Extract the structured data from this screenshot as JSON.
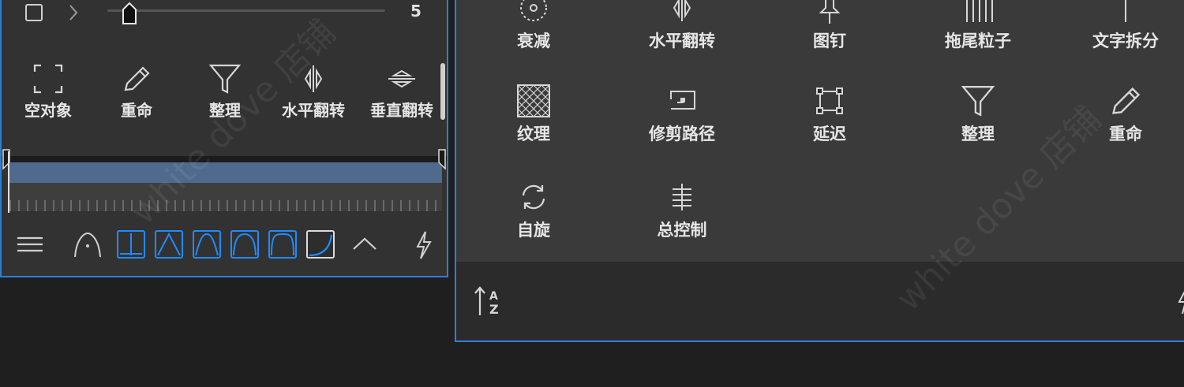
{
  "left_panel": {
    "slider_value": "5",
    "tools": [
      {
        "label": "空对象",
        "icon": "null-object-icon"
      },
      {
        "label": "重命",
        "icon": "pencil-icon"
      },
      {
        "label": "整理",
        "icon": "funnel-icon"
      },
      {
        "label": "水平翻转",
        "icon": "flip-horizontal-icon"
      },
      {
        "label": "垂直翻转",
        "icon": "flip-vertical-icon"
      }
    ]
  },
  "right_panel": {
    "items": [
      {
        "label": "衰减",
        "icon": "falloff-icon"
      },
      {
        "label": "水平翻转",
        "icon": "flip-horizontal-icon"
      },
      {
        "label": "图钉",
        "icon": "pin-icon"
      },
      {
        "label": "拖尾粒子",
        "icon": "trail-particles-icon"
      },
      {
        "label": "文字拆分",
        "icon": "text-split-icon"
      },
      {
        "label": "纹理",
        "icon": "texture-icon"
      },
      {
        "label": "修剪路径",
        "icon": "trim-path-icon"
      },
      {
        "label": "延迟",
        "icon": "delay-icon"
      },
      {
        "label": "整理",
        "icon": "funnel-icon"
      },
      {
        "label": "重命",
        "icon": "pencil-icon"
      },
      {
        "label": "自旋",
        "icon": "spin-icon"
      },
      {
        "label": "总控制",
        "icon": "master-control-icon"
      }
    ]
  },
  "watermark": "white dove 店铺",
  "colors": {
    "accent": "#1f8cff",
    "panel_border": "#2f7fd6",
    "timeline_bar": "#4f6a8c"
  }
}
